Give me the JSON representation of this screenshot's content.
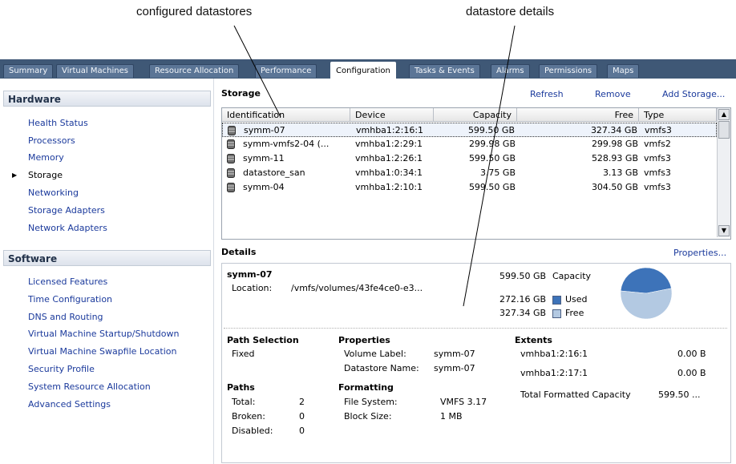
{
  "callouts": {
    "configured": "configured datastores",
    "details": "datastore details"
  },
  "tabs": [
    "Summary",
    "Virtual Machines",
    "Resource Allocation",
    "Performance",
    "Configuration",
    "Tasks & Events",
    "Alarms",
    "Permissions",
    "Maps"
  ],
  "active_tab": "Configuration",
  "hardware": {
    "title": "Hardware",
    "items": [
      "Health Status",
      "Processors",
      "Memory",
      "Storage",
      "Networking",
      "Storage Adapters",
      "Network Adapters"
    ],
    "selected": "Storage"
  },
  "software": {
    "title": "Software",
    "items": [
      "Licensed Features",
      "Time Configuration",
      "DNS and Routing",
      "Virtual Machine Startup/Shutdown",
      "Virtual Machine Swapfile Location",
      "Security Profile",
      "System Resource Allocation",
      "Advanced Settings"
    ]
  },
  "storage": {
    "title": "Storage",
    "refresh": "Refresh",
    "remove": "Remove",
    "add": "Add Storage...",
    "columns": [
      "Identification",
      "Device",
      "Capacity",
      "Free",
      "Type"
    ],
    "rows": [
      [
        "symm-07",
        "vmhba1:2:16:1",
        "599.50 GB",
        "327.34 GB",
        "vmfs3"
      ],
      [
        "symm-vmfs2-04 (...",
        "vmhba1:2:29:1",
        "299.98 GB",
        "299.98 GB",
        "vmfs2"
      ],
      [
        "symm-11",
        "vmhba1:2:26:1",
        "599.50 GB",
        "528.93 GB",
        "vmfs3"
      ],
      [
        "datastore_san",
        "vmhba1:0:34:1",
        "3.75 GB",
        "3.13 GB",
        "vmfs3"
      ],
      [
        "symm-04",
        "vmhba1:2:10:1",
        "599.50 GB",
        "304.50 GB",
        "vmfs3"
      ]
    ]
  },
  "details": {
    "title": "Details",
    "properties_link": "Properties...",
    "name": "symm-07",
    "location_label": "Location:",
    "location_value": "/vmfs/volumes/43fe4ce0-e3...",
    "capacity_value": "599.50 GB",
    "capacity_label": "Capacity",
    "used_value": "272.16 GB",
    "used_label": "Used",
    "free_value": "327.34 GB",
    "free_label": "Free",
    "used_fraction": 0.454,
    "colors": {
      "used": "#3d73b9",
      "free": "#b3c9e2"
    },
    "path_selection": {
      "title": "Path Selection",
      "value": "Fixed"
    },
    "properties": {
      "title": "Properties",
      "volume_label_k": "Volume Label:",
      "volume_label_v": "symm-07",
      "datastore_name_k": "Datastore Name:",
      "datastore_name_v": "symm-07"
    },
    "extents": {
      "title": "Extents",
      "rows": [
        [
          "vmhba1:2:16:1",
          "0.00 B"
        ],
        [
          "vmhba1:2:17:1",
          "0.00 B"
        ]
      ],
      "total_label": "Total Formatted Capacity",
      "total_value": "599.50 ..."
    },
    "paths": {
      "title": "Paths",
      "rows": [
        [
          "Total:",
          "2"
        ],
        [
          "Broken:",
          "0"
        ],
        [
          "Disabled:",
          "0"
        ]
      ]
    },
    "formatting": {
      "title": "Formatting",
      "fs_k": "File System:",
      "fs_v": "VMFS 3.17",
      "bs_k": "Block Size:",
      "bs_v": "1 MB"
    }
  }
}
